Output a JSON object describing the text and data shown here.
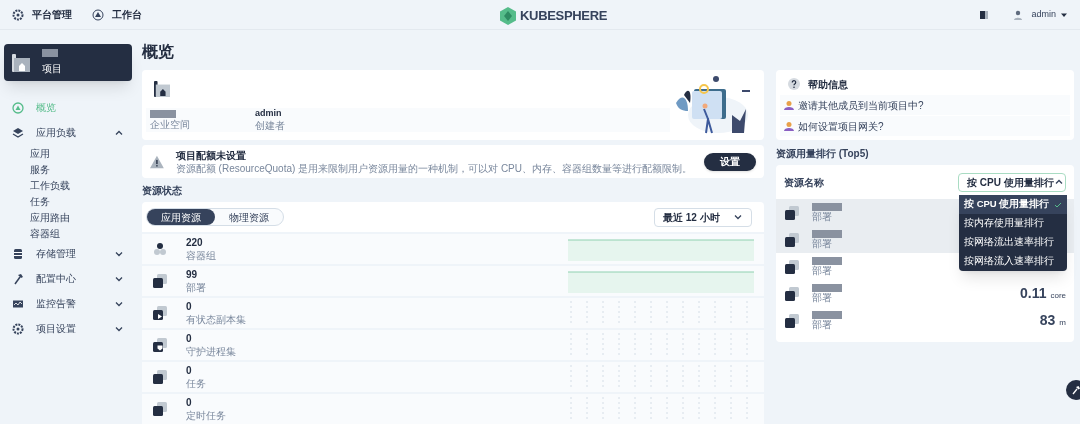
{
  "top_nav": {
    "items": [
      {
        "label": "平台管理",
        "kind": "gear"
      },
      {
        "label": "工作台",
        "kind": "dashboard"
      }
    ],
    "logo": "KUBESPHERE",
    "user": "admin"
  },
  "sidebar": {
    "project_type": "项目",
    "items": [
      {
        "label": "概览",
        "kind": "overview",
        "selected": true
      },
      {
        "label": "应用负载",
        "kind": "layers",
        "selected": false,
        "expanded": true,
        "children": [
          {
            "label": "应用",
            "selected": false
          },
          {
            "label": "服务",
            "selected": false
          },
          {
            "label": "工作负载",
            "selected": false
          },
          {
            "label": "任务",
            "selected": false
          },
          {
            "label": "应用路由",
            "selected": false
          },
          {
            "label": "容器组",
            "selected": false
          }
        ]
      },
      {
        "label": "存储管理",
        "kind": "storage",
        "selected": false,
        "expanded": false
      },
      {
        "label": "配置中心",
        "kind": "hammer",
        "selected": false,
        "expanded": false
      },
      {
        "label": "监控告警",
        "kind": "monitor",
        "selected": false,
        "expanded": false
      },
      {
        "label": "项目设置",
        "kind": "gear",
        "selected": false,
        "expanded": false
      }
    ]
  },
  "page_title": "概览",
  "project": {
    "workspace_label": "企业空间",
    "creator": "admin",
    "creator_label": "创建者"
  },
  "quota_alert": {
    "title": "项目配额未设置",
    "description": "资源配额 (ResourceQuota) 是用来限制用户资源用量的一种机制，可以对 CPU、内存、容器组数量等进行配额限制。",
    "button": "设置"
  },
  "resource_status": {
    "heading": "资源状态",
    "tabs": [
      {
        "label": "应用资源",
        "selected": true
      },
      {
        "label": "物理资源",
        "selected": false
      }
    ],
    "time_range": "最近 12 小时",
    "rows": [
      {
        "count": "220",
        "label": "容器组",
        "kind": "pods",
        "has_usage": true
      },
      {
        "count": "99",
        "label": "部署",
        "kind": "deployment",
        "has_usage": true
      },
      {
        "count": "0",
        "label": "有状态副本集",
        "kind": "statefulset",
        "has_usage": false
      },
      {
        "count": "0",
        "label": "守护进程集",
        "kind": "daemonset",
        "has_usage": false
      },
      {
        "count": "0",
        "label": "任务",
        "kind": "job",
        "has_usage": false
      },
      {
        "count": "0",
        "label": "定时任务",
        "kind": "job",
        "has_usage": false
      }
    ]
  },
  "help": {
    "title": "帮助信息",
    "links": [
      "邀请其他成员到当前项目中?",
      "如何设置项目网关?"
    ]
  },
  "ranking": {
    "heading": "资源用量排行 (Top5)",
    "column": "资源名称",
    "sort_select": "按 CPU 使用量排行",
    "expanded": true,
    "options": [
      {
        "label": "按 CPU 使用量排行",
        "selected": true
      },
      {
        "label": "按内存使用量排行",
        "selected": false
      },
      {
        "label": "按网络流出速率排行",
        "selected": false
      },
      {
        "label": "按网络流入速率排行",
        "selected": false
      }
    ],
    "rows": [
      {
        "type": "部署",
        "highlighted": true
      },
      {
        "type": "部署",
        "highlighted": true
      },
      {
        "type": "部署",
        "highlighted": false
      },
      {
        "type": "部署",
        "highlighted": false,
        "value": "0.11",
        "unit": "core"
      },
      {
        "type": "部署",
        "highlighted": false,
        "value": "83",
        "unit": "m"
      }
    ]
  }
}
